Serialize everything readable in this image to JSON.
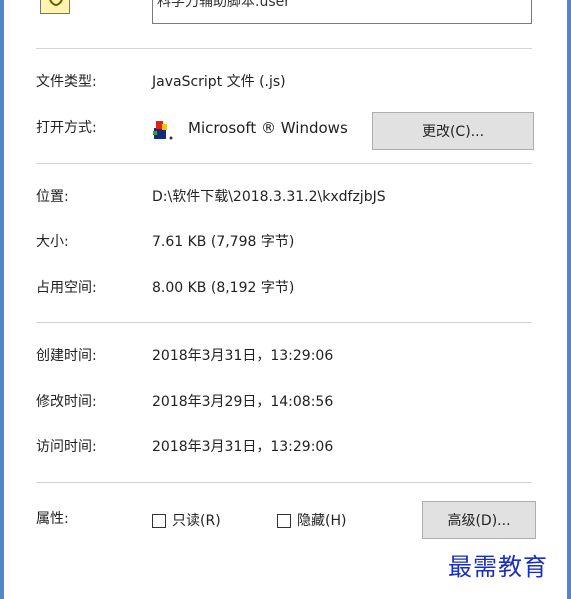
{
  "file": {
    "name": "科学刀辅助脚本.user",
    "icon": "script-file-icon"
  },
  "properties": {
    "type_label": "文件类型:",
    "type_value": "JavaScript 文件 (.js)",
    "opens_with_label": "打开方式:",
    "opens_with_value": "Microsoft ® Windows",
    "change_button": "更改(C)...",
    "location_label": "位置:",
    "location_value": "D:\\软件下载\\2018.3.31.2\\kxdfzjbJS",
    "size_label": "大小:",
    "size_value": "7.61 KB (7,798 字节)",
    "size_on_disk_label": "占用空间:",
    "size_on_disk_value": "8.00 KB (8,192 字节)",
    "created_label": "创建时间:",
    "created_value": "2018年3月31日，13:29:06",
    "modified_label": "修改时间:",
    "modified_value": "2018年3月29日，14:08:56",
    "accessed_label": "访问时间:",
    "accessed_value": "2018年3月31日，13:29:06"
  },
  "attributes": {
    "label": "属性:",
    "readonly_label": "只读(R)",
    "readonly_checked": false,
    "hidden_label": "隐藏(H)",
    "hidden_checked": false,
    "advanced_button": "高级(D)..."
  },
  "watermark": "最需教育",
  "colors": {
    "frame": "#4f86cc",
    "watermark": "#1a2fbf",
    "button_bg": "#e1e1e1"
  }
}
